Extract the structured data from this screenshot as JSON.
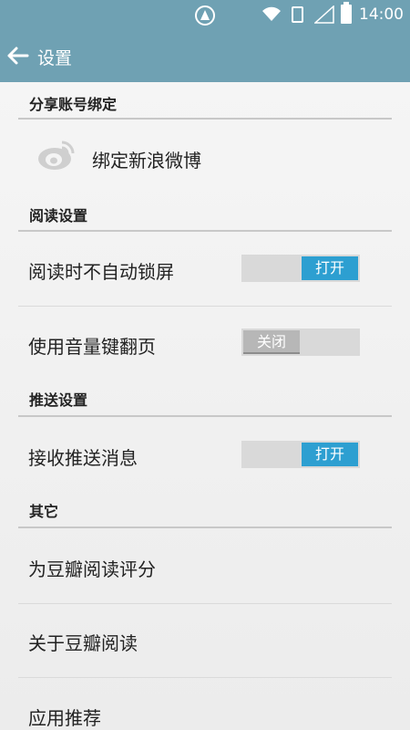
{
  "status_bar": {
    "time": "14:00",
    "icons": [
      "navigation-icon",
      "wifi-icon",
      "sim-card-icon",
      "signal-icon",
      "battery-icon"
    ]
  },
  "app_bar": {
    "back_icon": "arrow-left-icon",
    "title": "设置"
  },
  "sections": {
    "share": {
      "header": "分享账号绑定",
      "weibo_label": "绑定新浪微博",
      "weibo_icon": "weibo-icon"
    },
    "reading": {
      "header": "阅读设置",
      "no_lock": {
        "label": "阅读时不自动锁屏",
        "toggle": "打开",
        "enabled": true
      },
      "volume_page": {
        "label": "使用音量键翻页",
        "toggle": "关闭",
        "enabled": false
      }
    },
    "push": {
      "header": "推送设置",
      "receive": {
        "label": "接收推送消息",
        "toggle": "打开",
        "enabled": true
      }
    },
    "other": {
      "header": "其它",
      "rate": "为豆瓣阅读评分",
      "about": "关于豆瓣阅读",
      "recommend": "应用推荐"
    }
  },
  "colors": {
    "app_bar": "#6fa1b3",
    "toggle_on": "#2d9fd1",
    "toggle_off": "#b7b7b7"
  }
}
